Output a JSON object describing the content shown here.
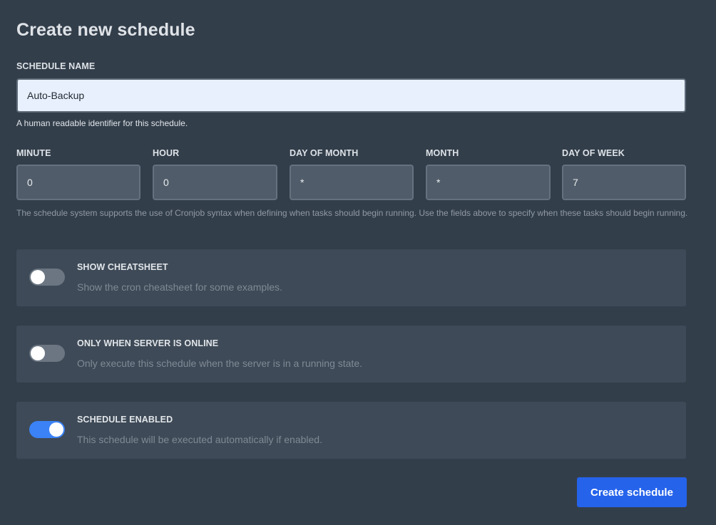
{
  "form": {
    "title": "Create new schedule",
    "schedule_name": {
      "label": "SCHEDULE NAME",
      "value": "Auto-Backup",
      "helper": "A human readable identifier for this schedule."
    },
    "cron": {
      "minute": {
        "label": "MINUTE",
        "value": "0"
      },
      "hour": {
        "label": "HOUR",
        "value": "0"
      },
      "day_of_month": {
        "label": "DAY OF MONTH",
        "value": "*"
      },
      "month": {
        "label": "MONTH",
        "value": "*"
      },
      "day_of_week": {
        "label": "DAY OF WEEK",
        "value": "7"
      },
      "helper": "The schedule system supports the use of Cronjob syntax when defining when tasks should begin running. Use the fields above to specify when these tasks should begin running."
    },
    "toggles": [
      {
        "title": "SHOW CHEATSHEET",
        "description": "Show the cron cheatsheet for some examples.",
        "enabled": false
      },
      {
        "title": "ONLY WHEN SERVER IS ONLINE",
        "description": "Only execute this schedule when the server is in a running state.",
        "enabled": false
      },
      {
        "title": "SCHEDULE ENABLED",
        "description": "This schedule will be executed automatically if enabled.",
        "enabled": true
      }
    ],
    "submit_label": "Create schedule"
  },
  "colors": {
    "background": "#333e4b",
    "card": "#3e4a57",
    "toggle_on": "#3b82f6",
    "toggle_off": "#6b7682",
    "primary_button": "#2563eb"
  }
}
